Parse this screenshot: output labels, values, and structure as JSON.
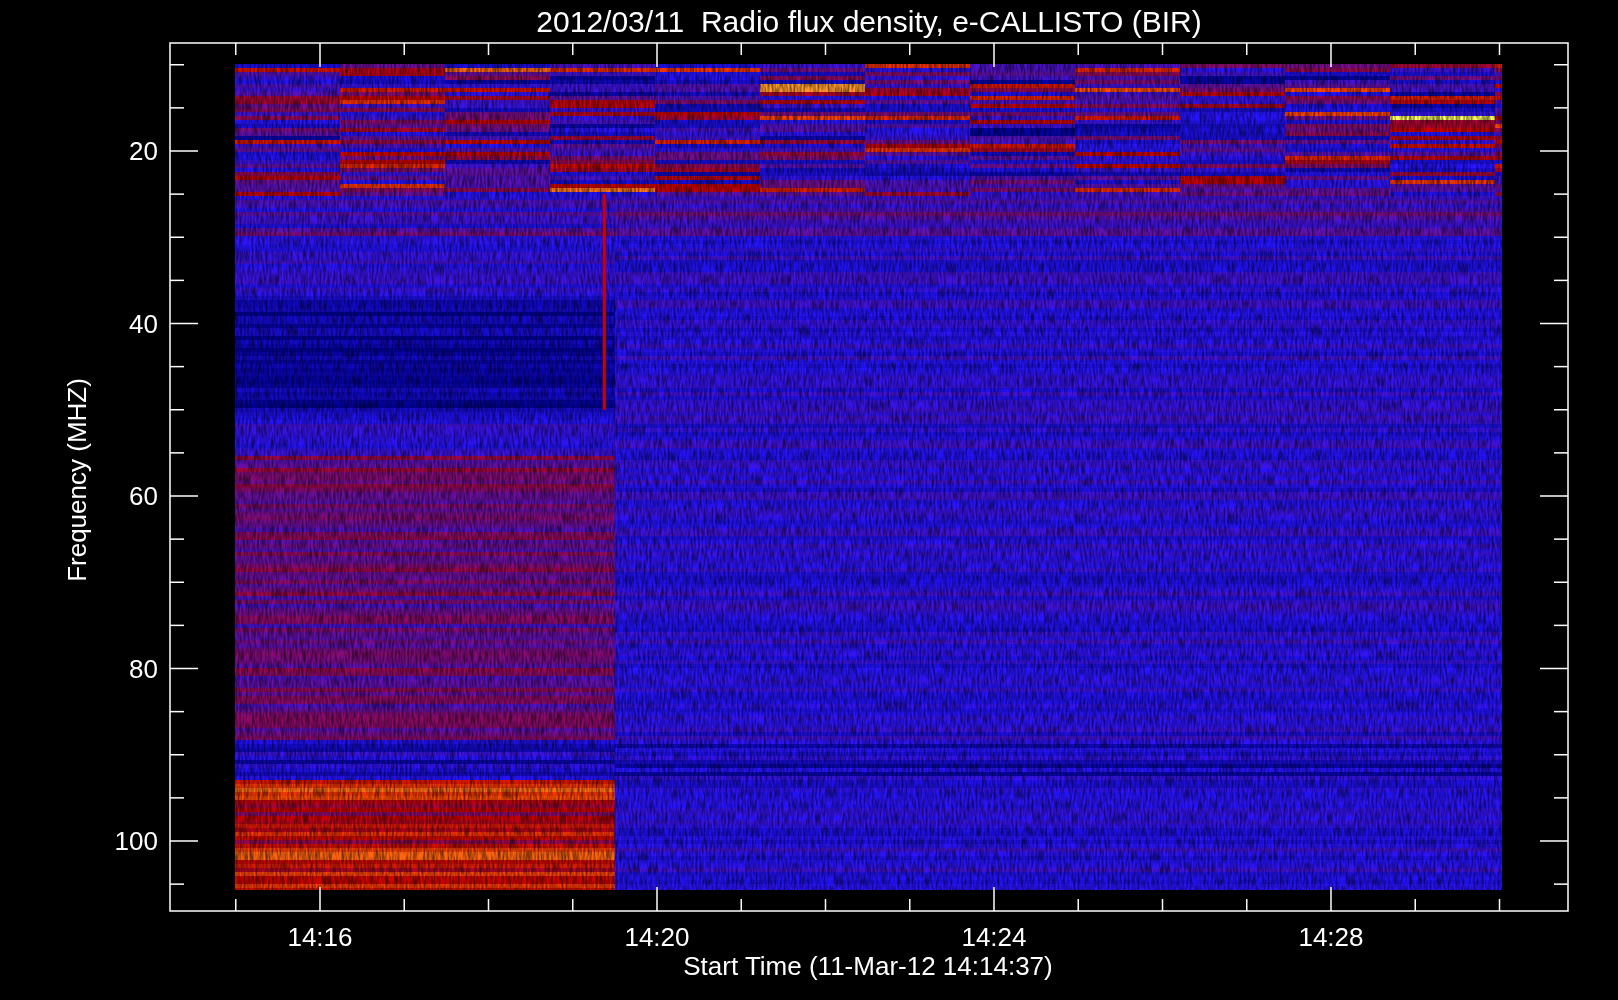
{
  "title": "2012/03/11  Radio flux density, e-CALLISTO (BIR)",
  "plot": {
    "ylabel": "Frequency (MHZ)",
    "xlabel": "Start Time (11-Mar-12 14:14:37)",
    "yticks": [
      "20",
      "40",
      "60",
      "80",
      "100"
    ],
    "xticks": [
      "14:16",
      "14:20",
      "14:24",
      "14:28"
    ]
  }
}
